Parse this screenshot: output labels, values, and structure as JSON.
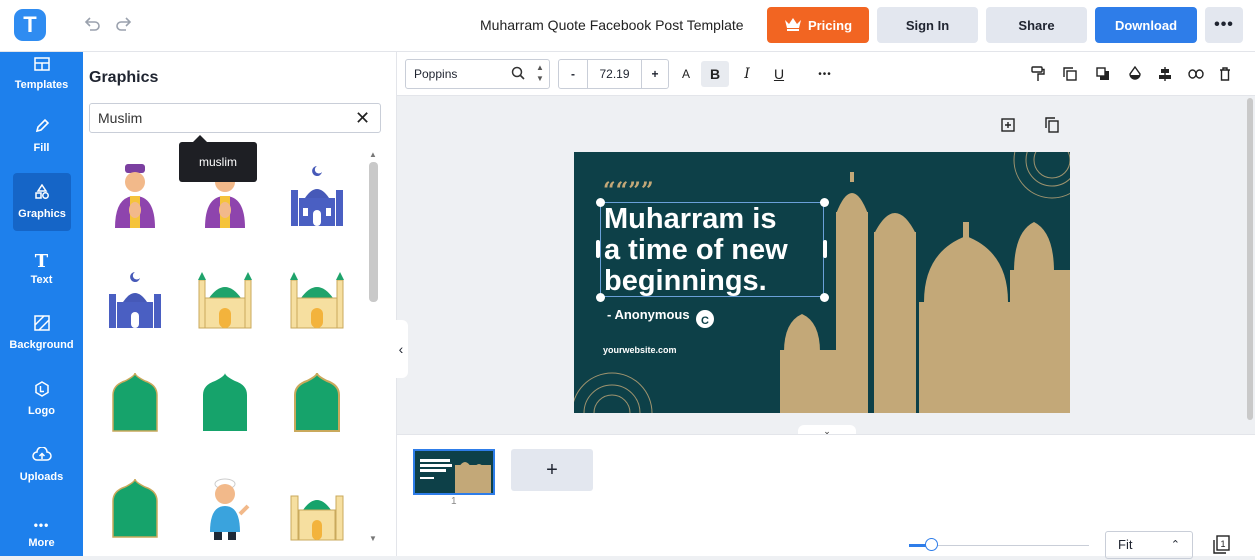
{
  "header": {
    "logo_letter": "T",
    "title": "Muharram Quote Facebook Post Template",
    "pricing_label": "Pricing",
    "signin_label": "Sign In",
    "share_label": "Share",
    "download_label": "Download",
    "more_label": "•••"
  },
  "colors": {
    "brand_blue": "#1e80ec",
    "pricing_orange": "#f26522",
    "download_blue": "#2e7de9",
    "design_bg": "#0d4048",
    "mosque_gold": "#c3a878"
  },
  "sidebar": {
    "items": [
      {
        "label": "Templates",
        "icon": "templates-icon"
      },
      {
        "label": "Fill",
        "icon": "pencil-icon"
      },
      {
        "label": "Graphics",
        "icon": "shapes-icon"
      },
      {
        "label": "Text",
        "icon": "text-icon"
      },
      {
        "label": "Background",
        "icon": "background-icon"
      },
      {
        "label": "Logo",
        "icon": "logo-icon"
      },
      {
        "label": "Uploads",
        "icon": "cloud-upload-icon"
      },
      {
        "label": "More",
        "icon": "more-dots-icon"
      }
    ],
    "active": "Graphics"
  },
  "panel": {
    "title": "Graphics",
    "search_value": "Muslim",
    "tooltip": "muslim"
  },
  "toolbar": {
    "font": "Poppins",
    "font_size": "72.19",
    "minus": "-",
    "plus": "+",
    "case_label": "A",
    "bold_label": "B",
    "italic_label": "I",
    "underline_label": "U",
    "more_label": "•••"
  },
  "design": {
    "quote_mark": "““””",
    "line1": "Muharram is",
    "line2": "a time of new",
    "line3": "beginnings.",
    "author": "- Anonymous",
    "website": "yourwebsite.com"
  },
  "pages": {
    "page_number": "1",
    "add_label": "+"
  },
  "zoom": {
    "fit_label": "Fit"
  }
}
